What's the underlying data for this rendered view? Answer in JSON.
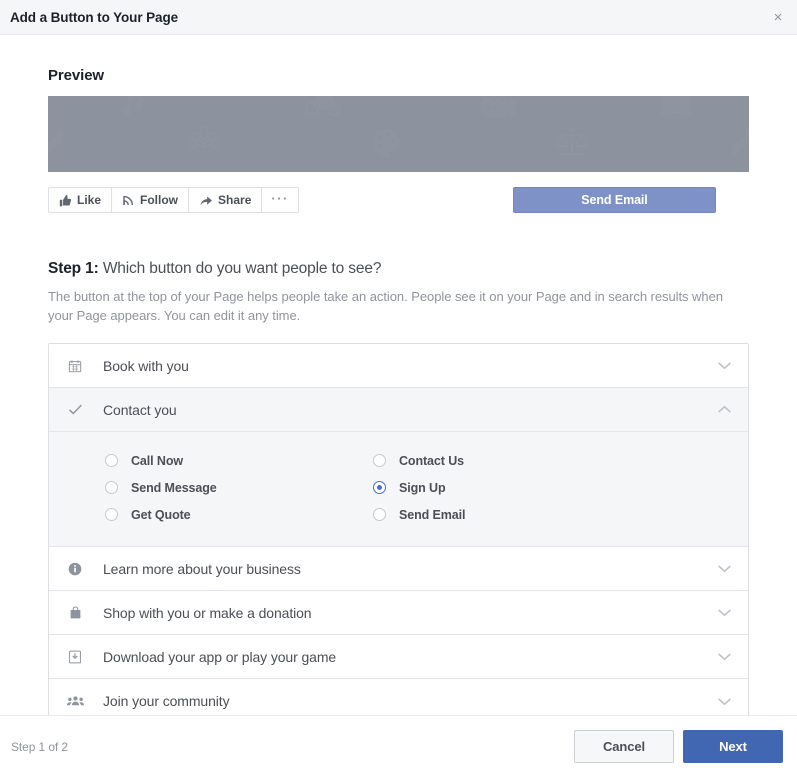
{
  "dialog": {
    "title": "Add a Button to Your Page",
    "close_label": "×"
  },
  "preview": {
    "heading": "Preview",
    "social_buttons": [
      {
        "label": "Like",
        "icon": "thumbs-up-icon"
      },
      {
        "label": "Follow",
        "icon": "rss-icon"
      },
      {
        "label": "Share",
        "icon": "share-arrow-icon"
      },
      {
        "label": "···",
        "icon": "ellipsis-icon"
      }
    ],
    "cta_button_label": "Send Email",
    "cta_button_color": "#7e92c8",
    "cover_color": "#8d939e"
  },
  "step": {
    "label": "Step 1:",
    "question": "Which button do you want people to see?",
    "description": "The button at the top of your Page helps people take an action. People see it on your Page and in search results when your Page appears. You can edit it any time."
  },
  "accordion": {
    "items": [
      {
        "label": "Book with you",
        "icon": "calendar-icon",
        "expanded": false,
        "chevron": "chevron-down-icon"
      },
      {
        "label": "Contact you",
        "icon": "check-icon",
        "expanded": true,
        "chevron": "chevron-up-icon"
      },
      {
        "label": "Learn more about your business",
        "icon": "info-circle-icon",
        "expanded": false,
        "chevron": "chevron-down-icon"
      },
      {
        "label": "Shop with you or make a donation",
        "icon": "shopping-bag-icon",
        "expanded": false,
        "chevron": "chevron-down-icon"
      },
      {
        "label": "Download your app or play your game",
        "icon": "download-icon",
        "expanded": false,
        "chevron": "chevron-down-icon"
      },
      {
        "label": "Join your community",
        "icon": "people-group-icon",
        "expanded": false,
        "chevron": "chevron-down-icon"
      }
    ]
  },
  "contact_options": {
    "column_left": [
      {
        "label": "Call Now",
        "selected": false
      },
      {
        "label": "Send Message",
        "selected": false
      },
      {
        "label": "Get Quote",
        "selected": false
      }
    ],
    "column_right": [
      {
        "label": "Contact Us",
        "selected": false
      },
      {
        "label": "Sign Up",
        "selected": true
      },
      {
        "label": "Send Email",
        "selected": false
      }
    ],
    "selected_value": "Sign Up",
    "selected_color": "#4a72c4"
  },
  "footer": {
    "step_counter": "Step 1 of 2",
    "cancel_label": "Cancel",
    "next_label": "Next",
    "next_color": "#4267b2"
  }
}
